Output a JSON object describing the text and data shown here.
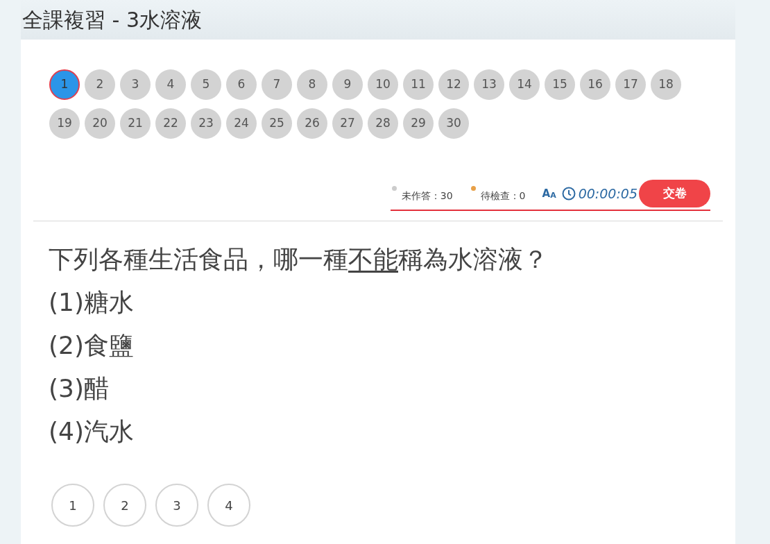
{
  "title": "全課複習 - 3水溶液",
  "question_numbers": [
    {
      "label": "1",
      "selected": true
    },
    {
      "label": "2",
      "selected": false
    },
    {
      "label": "3",
      "selected": false
    },
    {
      "label": "4",
      "selected": false
    },
    {
      "label": "5",
      "selected": false
    },
    {
      "label": "6",
      "selected": false
    },
    {
      "label": "7",
      "selected": false
    },
    {
      "label": "8",
      "selected": false
    },
    {
      "label": "9",
      "selected": false
    },
    {
      "label": "10",
      "selected": false
    },
    {
      "label": "11",
      "selected": false
    },
    {
      "label": "12",
      "selected": false
    },
    {
      "label": "13",
      "selected": false
    },
    {
      "label": "14",
      "selected": false
    },
    {
      "label": "15",
      "selected": false
    },
    {
      "label": "16",
      "selected": false
    },
    {
      "label": "17",
      "selected": false
    },
    {
      "label": "18",
      "selected": false
    },
    {
      "label": "19",
      "selected": false
    },
    {
      "label": "20",
      "selected": false
    },
    {
      "label": "21",
      "selected": false
    },
    {
      "label": "22",
      "selected": false
    },
    {
      "label": "23",
      "selected": false
    },
    {
      "label": "24",
      "selected": false
    },
    {
      "label": "25",
      "selected": false
    },
    {
      "label": "26",
      "selected": false
    },
    {
      "label": "27",
      "selected": false
    },
    {
      "label": "28",
      "selected": false
    },
    {
      "label": "29",
      "selected": false
    },
    {
      "label": "30",
      "selected": false
    }
  ],
  "status": [
    {
      "label": "未作答：30",
      "color": "#cccccc"
    },
    {
      "label": "待檢查：0",
      "color": "#e8a048"
    }
  ],
  "text_size_button": {
    "big": "A",
    "small": "A"
  },
  "timer": "00:00:05",
  "submit_button": "交卷",
  "question": {
    "parts": [
      {
        "text": "下列各種生活食品，哪一種",
        "underlined": false
      },
      {
        "text": "不能",
        "underlined": true
      },
      {
        "text": "稱為水溶液？",
        "underlined": false
      }
    ],
    "options": [
      "(1)糖水",
      "(2)食鹽",
      "(3)醋",
      "(4)汽水"
    ]
  },
  "answers": [
    {
      "label": "1",
      "selected": false
    },
    {
      "label": "2",
      "selected": false
    },
    {
      "label": "3",
      "selected": false
    },
    {
      "label": "4",
      "selected": false
    }
  ]
}
